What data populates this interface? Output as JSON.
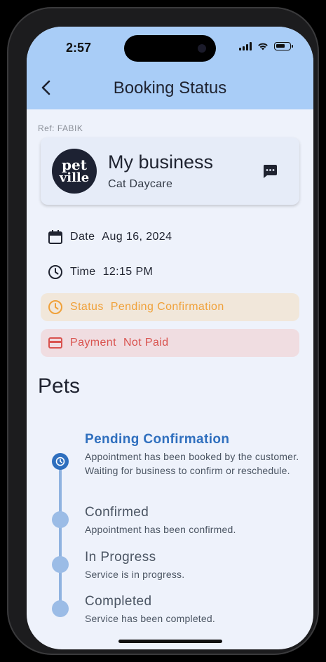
{
  "status_bar": {
    "time": "2:57"
  },
  "header": {
    "title": "Booking Status"
  },
  "booking": {
    "ref": "Ref: FABIK",
    "business": {
      "logo_line1": "pet",
      "logo_line2": "ville",
      "name": "My business",
      "service": "Cat Daycare"
    },
    "date_label": "Date",
    "date_value": "Aug 16, 2024",
    "time_label": "Time",
    "time_value": "12:15 PM",
    "status_label": "Status",
    "status_value": "Pending Confirmation",
    "payment_label": "Payment",
    "payment_value": "Not Paid"
  },
  "pets": {
    "heading": "Pets"
  },
  "timeline": [
    {
      "title": "Pending Confirmation",
      "desc": "Appointment has been booked by the customer. Waiting for business to confirm or reschedule."
    },
    {
      "title": "Confirmed",
      "desc": "Appointment has been confirmed."
    },
    {
      "title": "In Progress",
      "desc": "Service is in progress."
    },
    {
      "title": "Completed",
      "desc": "Service has been completed."
    }
  ],
  "colors": {
    "header_bg": "#a9cdf7",
    "accent": "#2f6fbe",
    "pending": "#f0a13a",
    "unpaid": "#d9534f"
  },
  "icons": [
    "back-arrow-icon",
    "chat-icon",
    "calendar-icon",
    "clock-icon",
    "status-clock-icon",
    "credit-card-icon"
  ]
}
